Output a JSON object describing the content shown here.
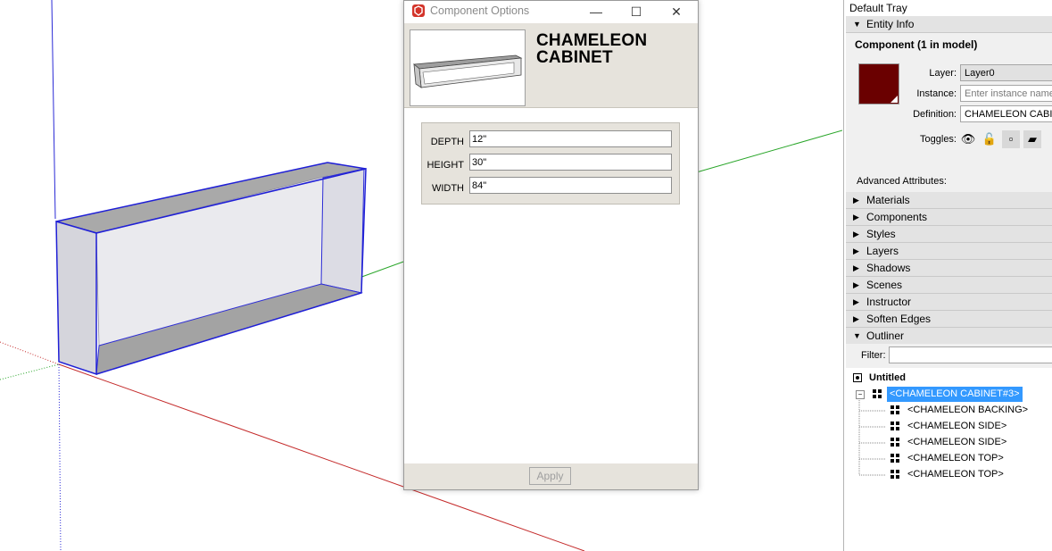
{
  "dialog": {
    "title": "Component Options",
    "component_name": "CHAMELEON CABINET",
    "attributes": [
      {
        "label": "DEPTH",
        "value": "12\""
      },
      {
        "label": "HEIGHT",
        "value": "30\""
      },
      {
        "label": "WIDTH",
        "value": "84\""
      }
    ],
    "apply_label": "Apply"
  },
  "tray": {
    "title": "Default Tray",
    "entity_info": {
      "section_label": "Entity Info",
      "header": "Component (1 in model)",
      "swatch_color": "#6a0000",
      "layer_label": "Layer:",
      "layer_value": "Layer0",
      "instance_label": "Instance:",
      "instance_placeholder": "Enter instance name",
      "definition_label": "Definition:",
      "definition_value": "CHAMELEON CABINET",
      "toggles_label": "Toggles:",
      "advanced_label": "Advanced Attributes:"
    },
    "sections": [
      "Materials",
      "Components",
      "Styles",
      "Layers",
      "Shadows",
      "Scenes",
      "Instructor",
      "Soften Edges"
    ],
    "outliner": {
      "section_label": "Outliner",
      "filter_label": "Filter:",
      "root": "Untitled",
      "selected": "<CHAMELEON CABINET#3>",
      "children": [
        "<CHAMELEON BACKING>",
        "<CHAMELEON SIDE>",
        "<CHAMELEON SIDE>",
        "<CHAMELEON TOP>",
        "<CHAMELEON TOP>"
      ]
    }
  }
}
